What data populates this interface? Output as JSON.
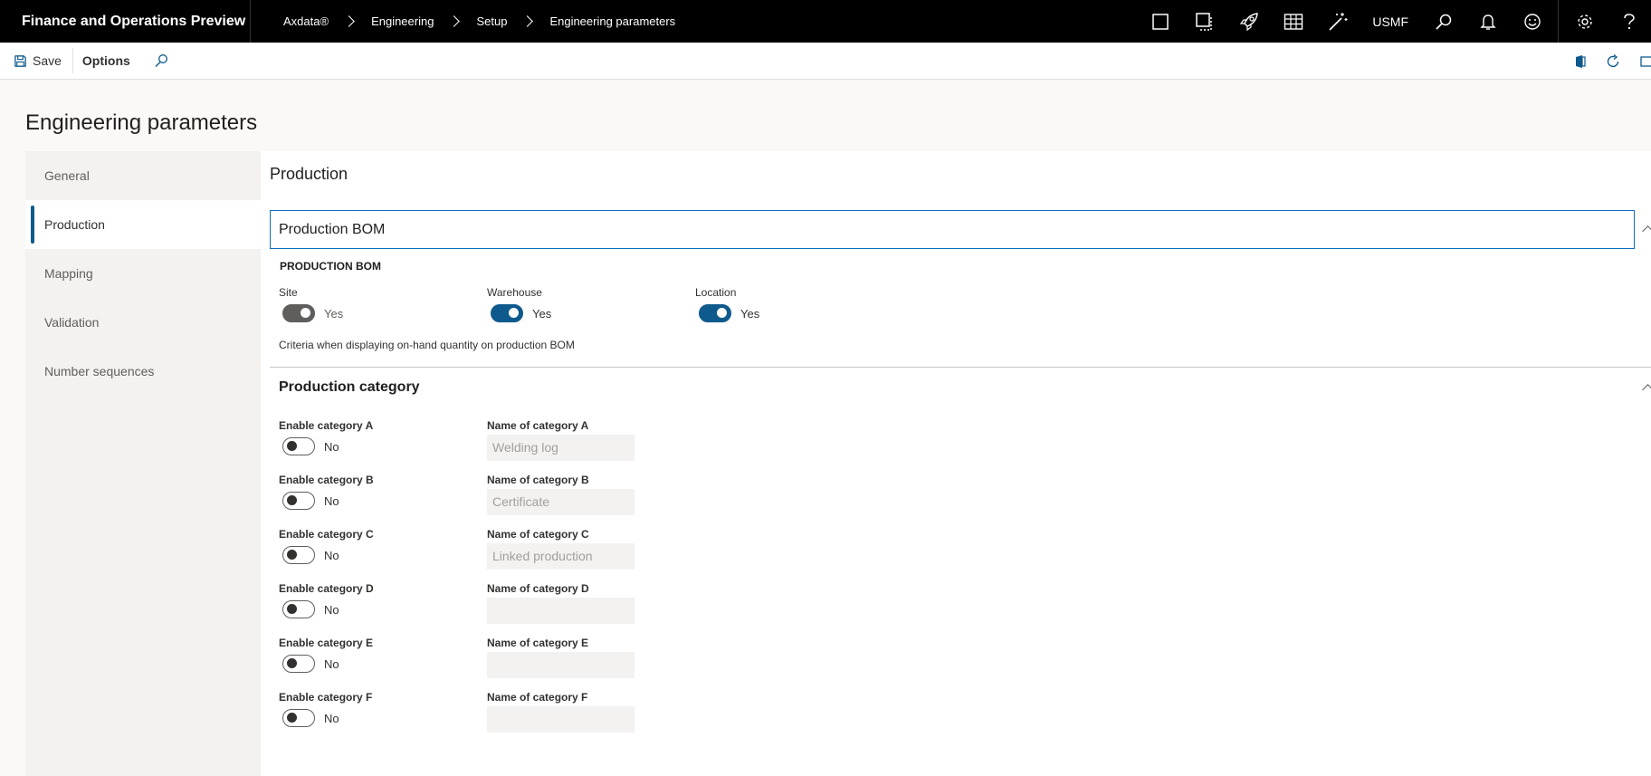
{
  "header": {
    "app_title": "Finance and Operations Preview",
    "breadcrumb": [
      "Axdata®",
      "Engineering",
      "Setup",
      "Engineering parameters"
    ],
    "company": "USMF"
  },
  "actionbar": {
    "save_label": "Save",
    "options_label": "Options"
  },
  "page": {
    "title": "Engineering parameters"
  },
  "tabs": [
    {
      "label": "General",
      "active": false
    },
    {
      "label": "Production",
      "active": true
    },
    {
      "label": "Mapping",
      "active": false
    },
    {
      "label": "Validation",
      "active": false
    },
    {
      "label": "Number sequences",
      "active": false
    }
  ],
  "production": {
    "title": "Production",
    "bom_fasttab": {
      "header": "Production BOM",
      "group_label": "PRODUCTION BOM",
      "fields": [
        {
          "label": "Site",
          "value": "Yes"
        },
        {
          "label": "Warehouse",
          "value": "Yes"
        },
        {
          "label": "Location",
          "value": "Yes"
        }
      ],
      "note": "Criteria when displaying on-hand quantity on production BOM"
    },
    "category_fasttab": {
      "header": "Production category",
      "rows": [
        {
          "enable_label": "Enable category A",
          "enable_value": "No",
          "name_label": "Name of category A",
          "name_value": "Welding log"
        },
        {
          "enable_label": "Enable category B",
          "enable_value": "No",
          "name_label": "Name of category B",
          "name_value": "Certificate"
        },
        {
          "enable_label": "Enable category C",
          "enable_value": "No",
          "name_label": "Name of category C",
          "name_value": "Linked production"
        },
        {
          "enable_label": "Enable category D",
          "enable_value": "No",
          "name_label": "Name of category D",
          "name_value": ""
        },
        {
          "enable_label": "Enable category E",
          "enable_value": "No",
          "name_label": "Name of category E",
          "name_value": ""
        },
        {
          "enable_label": "Enable category F",
          "enable_value": "No",
          "name_label": "Name of category F",
          "name_value": ""
        }
      ]
    }
  },
  "colors": {
    "accent": "#0f5a8c",
    "topbar": "#000000",
    "fasttab_border": "#0f6cbd"
  },
  "icons": {
    "top": [
      "square-icon",
      "split-window-icon",
      "rocket-icon",
      "grid-icon",
      "magic-wand-icon",
      "search-icon",
      "bell-icon",
      "smiley-icon",
      "gear-icon",
      "help-icon"
    ],
    "action": [
      "save-icon",
      "search-icon",
      "office-icon",
      "refresh-icon",
      "open-in-new-icon"
    ]
  }
}
